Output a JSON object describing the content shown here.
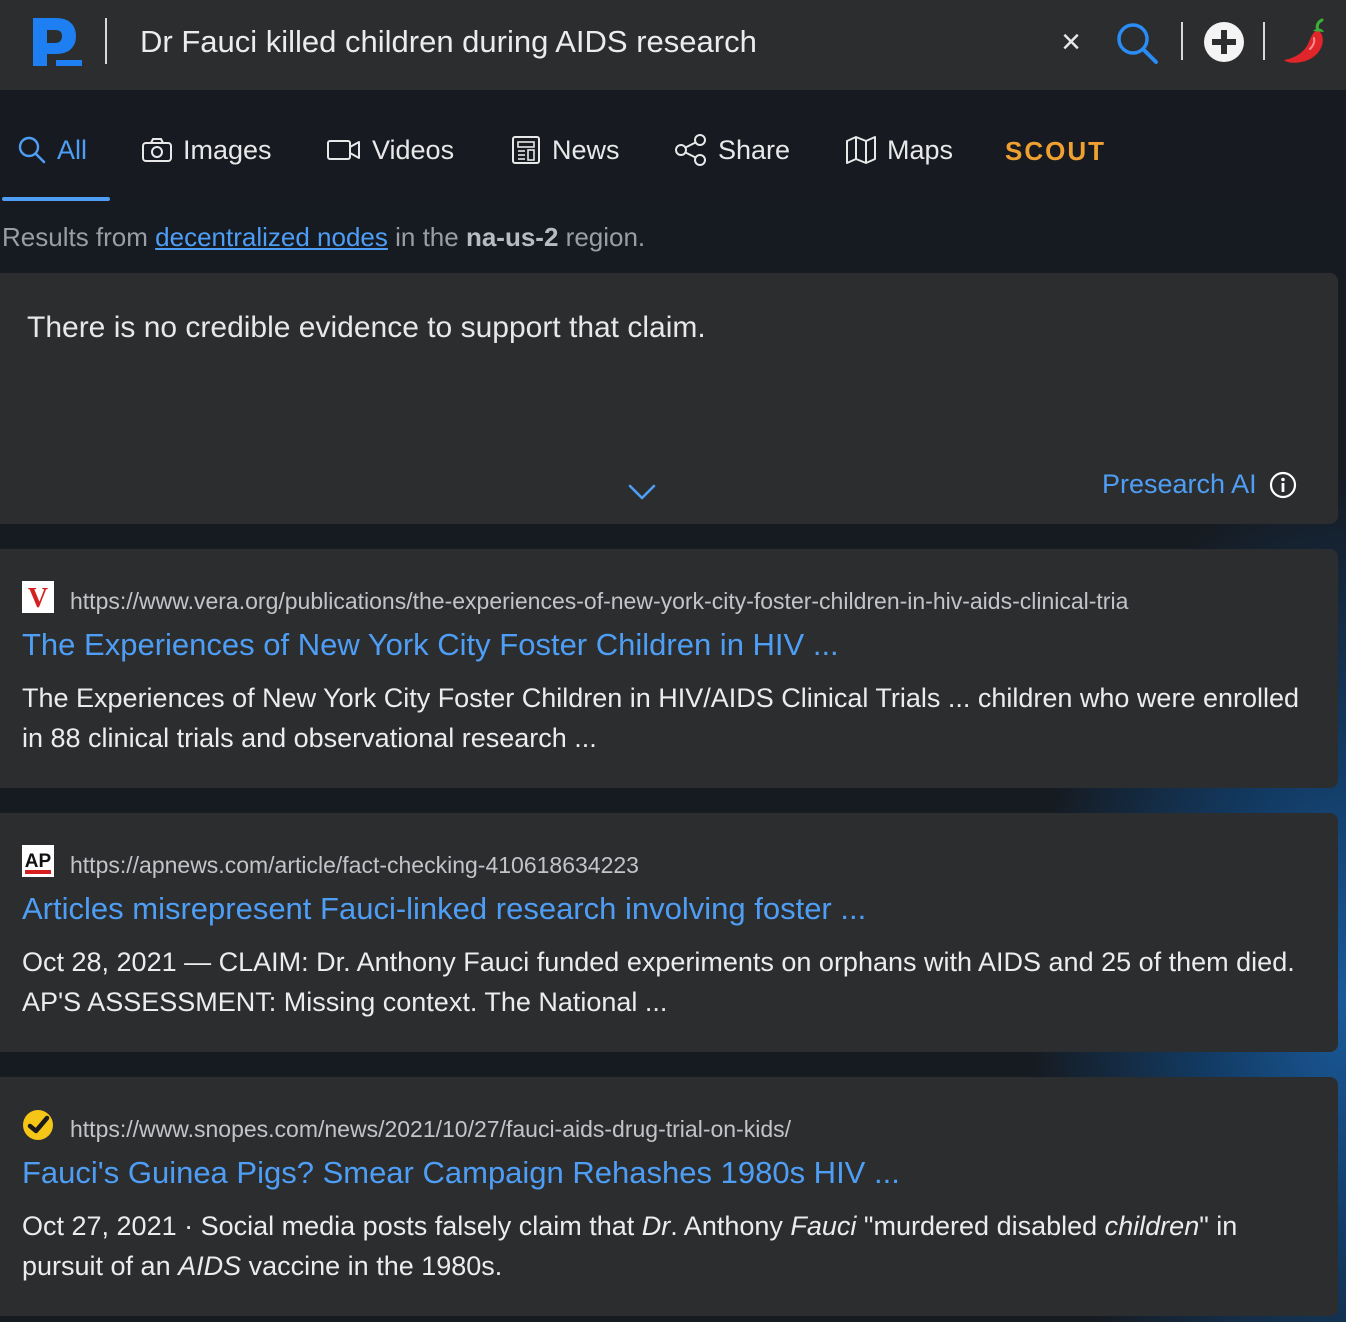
{
  "search": {
    "query": "Dr Fauci killed children during AIDS research"
  },
  "tabs": [
    {
      "label": "All",
      "icon": "search-icon",
      "active": true
    },
    {
      "label": "Images",
      "icon": "camera-icon"
    },
    {
      "label": "Videos",
      "icon": "video-icon"
    },
    {
      "label": "News",
      "icon": "newspaper-icon"
    },
    {
      "label": "Share",
      "icon": "share-icon"
    },
    {
      "label": "Maps",
      "icon": "map-icon"
    }
  ],
  "scout": {
    "label": "SCOUT"
  },
  "region": {
    "prefix": "Results from",
    "link": "decentralized nodes",
    "middle": "in the",
    "name": "na-us-2",
    "suffix": "region."
  },
  "ai": {
    "answer": "There is no credible evidence to support that claim.",
    "brand": "Presearch AI"
  },
  "results": [
    {
      "favicon": "vera-logo",
      "favicon_text": "V",
      "url": "https://www.vera.org/publications/the-experiences-of-new-york-city-foster-children-in-hiv-aids-clinical-tria",
      "title": "The Experiences of New York City Foster Children in HIV ...",
      "snippet": "The Experiences of New York City Foster Children in HIV/AIDS Clinical Trials ... children who were enrolled in 88 clinical trials and observational research ..."
    },
    {
      "favicon": "ap-logo",
      "favicon_text": "AP",
      "url": "https://apnews.com/article/fact-checking-410618634223",
      "title": "Articles misrepresent Fauci-linked research involving foster ...",
      "snippet": "Oct 28, 2021 — CLAIM: Dr. Anthony Fauci funded experiments on orphans with AIDS and 25 of them died. AP'S ASSESSMENT: Missing context. The National ..."
    },
    {
      "favicon": "snopes-logo",
      "url": "https://www.snopes.com/news/2021/10/27/fauci-aids-drug-trial-on-kids/",
      "title": "Fauci's Guinea Pigs? Smear Campaign Rehashes 1980s HIV ...",
      "snippet_parts": [
        "Oct 27, 2021 · Social media posts falsely claim that ",
        "Dr",
        ". Anthony ",
        "Fauci",
        " \"murdered disabled ",
        "children",
        "\" in pursuit of an ",
        "AIDS",
        " vaccine in the 1980s."
      ]
    }
  ],
  "colors": {
    "accent": "#4e9ef5",
    "scout": "#f0a030",
    "card": "#2c2d2f"
  }
}
